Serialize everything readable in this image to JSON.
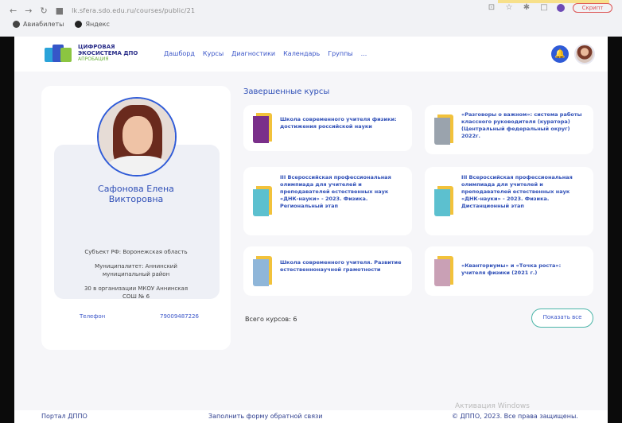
{
  "browser": {
    "url": "lk.sfera.sdo.edu.ru/courses/public/21",
    "bookmarks": [
      {
        "label": "Авиабилеты",
        "icon": "globe-icon"
      },
      {
        "label": "Яндекс",
        "icon": "yandex-icon"
      }
    ],
    "profile_button_label": "Скрипт"
  },
  "site": {
    "logo_line1": "ЦИФРОВАЯ",
    "logo_line2": "ЭКОСИСТЕМА ДПО",
    "logo_line3": "АПРОБАЦИЯ",
    "nav": [
      "Дашборд",
      "Курсы",
      "Диагностики",
      "Календарь",
      "Группы",
      "..."
    ]
  },
  "profile": {
    "name_line1": "Сафонова Елена",
    "name_line2": "Викторовна",
    "region": "Субъект РФ: Воронежская область",
    "municipality_line1": "Муниципалитет: Аннинский",
    "municipality_line2": "муниципальный район",
    "org_line1": "30 в организации МКОУ Аннинская",
    "org_line2": "СОШ № 6",
    "phone_label": "Телефон",
    "phone_value": "79009487226"
  },
  "courses": {
    "title": "Завершенные курсы",
    "items": [
      {
        "title": "Школа современного учителя физики: достижения российской науки",
        "thumb_color": "#7a2f8a"
      },
      {
        "title": "«Разговоры о важном»: система работы классного руководителя (куратора) (Центральный федеральный округ) 2022г.",
        "thumb_color": "#9aa3ad"
      },
      {
        "title": "III Всероссийская профессиональная олимпиада для учителей и преподавателей естественных наук «ДНК-науки» - 2023. Физика. Региональный этап",
        "thumb_color": "#5cc0cf"
      },
      {
        "title": "III Всероссийская профессиональная олимпиада для учителей и преподавателей естественных наук «ДНК-науки» - 2023. Физика. Дистанционный этап",
        "thumb_color": "#5cc0cf"
      },
      {
        "title": "Школа современного учителя. Развитие естественнонаучной грамотности",
        "thumb_color": "#8fb6d9"
      },
      {
        "title": "«Кванториумы» и «Точка роста»: учителя физики (2021 г.)",
        "thumb_color": "#c9a0b5"
      }
    ],
    "total_label": "Всего курсов: 6",
    "show_all_label": "Показать все"
  },
  "footer": {
    "left": "Портал ДППО",
    "middle": "Заполнить форму обратной связи",
    "right": "© ДППО, 2023. Все права защищены.",
    "watermark": "Активация Windows"
  }
}
